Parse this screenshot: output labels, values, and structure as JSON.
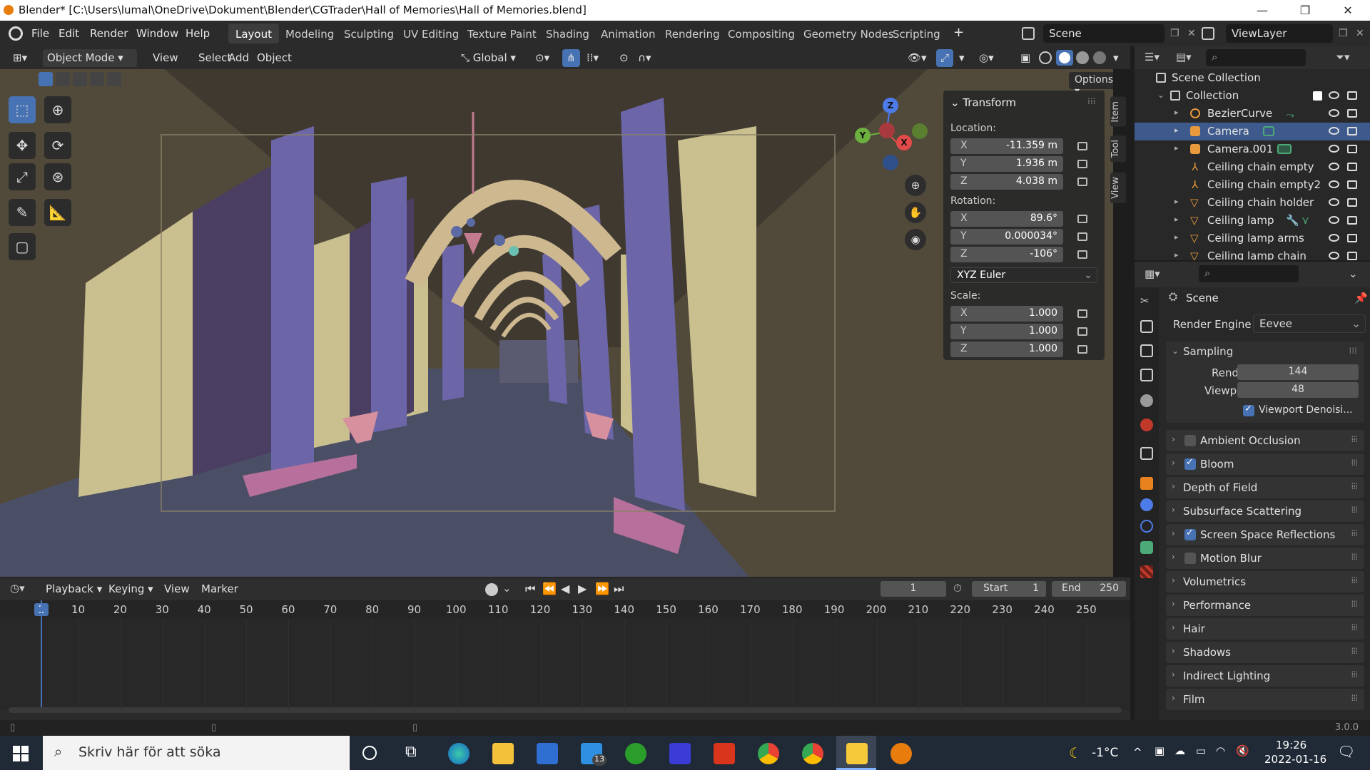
{
  "window": {
    "title": "Blender* [C:\\Users\\lumal\\OneDrive\\Dokument\\Blender\\CGTrader\\Hall of Memories\\Hall of Memories.blend]",
    "minimize": "—",
    "maximize": "❐",
    "close": "✕"
  },
  "menu": [
    "File",
    "Edit",
    "Render",
    "Window",
    "Help"
  ],
  "workspaces": [
    "Layout",
    "Modeling",
    "Sculpting",
    "UV Editing",
    "Texture Paint",
    "Shading",
    "Animation",
    "Rendering",
    "Compositing",
    "Geometry Nodes",
    "Scripting"
  ],
  "workspace_add": "+",
  "scene_name": "Scene",
  "viewlayer_name": "ViewLayer",
  "viewport_header": {
    "mode": "Object Mode",
    "menus": [
      "View",
      "Select",
      "Add",
      "Object"
    ],
    "orientation": "Global",
    "options": "Options"
  },
  "gizmo": {
    "x": "X",
    "y": "Y",
    "z": "Z"
  },
  "npanel": {
    "title": "Transform",
    "location_label": "Location:",
    "location": [
      {
        "axis": "X",
        "value": "-11.359 m"
      },
      {
        "axis": "Y",
        "value": "1.936 m"
      },
      {
        "axis": "Z",
        "value": "4.038 m"
      }
    ],
    "rotation_label": "Rotation:",
    "rotation": [
      {
        "axis": "X",
        "value": "89.6°"
      },
      {
        "axis": "Y",
        "value": "0.000034°"
      },
      {
        "axis": "Z",
        "value": "-106°"
      }
    ],
    "rotation_mode": "XYZ Euler",
    "scale_label": "Scale:",
    "scale": [
      {
        "axis": "X",
        "value": "1.000"
      },
      {
        "axis": "Y",
        "value": "1.000"
      },
      {
        "axis": "Z",
        "value": "1.000"
      }
    ],
    "tabs": [
      "Item",
      "Tool",
      "View"
    ]
  },
  "outliner": {
    "scene_collection": "Scene Collection",
    "collection": "Collection",
    "items": [
      "BezierCurve",
      "Camera",
      "Camera.001",
      "Ceiling chain empty",
      "Ceiling chain empty2",
      "Ceiling chain holder",
      "Ceiling lamp",
      "Ceiling lamp arms",
      "Ceiling lamp chain"
    ]
  },
  "properties": {
    "scene": "Scene",
    "render_engine_label": "Render Engine",
    "render_engine": "Eevee",
    "sampling": "Sampling",
    "render_label": "Render",
    "render_value": "144",
    "viewport_label": "Viewport",
    "viewport_value": "48",
    "viewport_denoise": "Viewport Denoisi...",
    "panels": [
      {
        "label": "Ambient Occlusion",
        "check": "off"
      },
      {
        "label": "Bloom",
        "check": "on"
      },
      {
        "label": "Depth of Field",
        "check": "none"
      },
      {
        "label": "Subsurface Scattering",
        "check": "none"
      },
      {
        "label": "Screen Space Reflections",
        "check": "on"
      },
      {
        "label": "Motion Blur",
        "check": "off"
      },
      {
        "label": "Volumetrics",
        "check": "none"
      },
      {
        "label": "Performance",
        "check": "none"
      },
      {
        "label": "Hair",
        "check": "none"
      },
      {
        "label": "Shadows",
        "check": "none"
      },
      {
        "label": "Indirect Lighting",
        "check": "none"
      },
      {
        "label": "Film",
        "check": "none"
      }
    ]
  },
  "timeline": {
    "menus": [
      "Playback",
      "Keying",
      "View",
      "Marker"
    ],
    "current_frame": "1",
    "start_label": "Start",
    "start": "1",
    "end_label": "End",
    "end": "250",
    "ticks": [
      "1",
      "10",
      "20",
      "30",
      "40",
      "50",
      "60",
      "70",
      "80",
      "90",
      "100",
      "110",
      "120",
      "130",
      "140",
      "150",
      "160",
      "170",
      "180",
      "190",
      "200",
      "210",
      "220",
      "230",
      "240",
      "250"
    ]
  },
  "status": {
    "version": "3.0.0"
  },
  "taskbar": {
    "search_placeholder": "Skriv här för att söka",
    "mail_badge": "13",
    "temperature": "-1°C",
    "time": "19:26",
    "date": "2022-01-16"
  }
}
